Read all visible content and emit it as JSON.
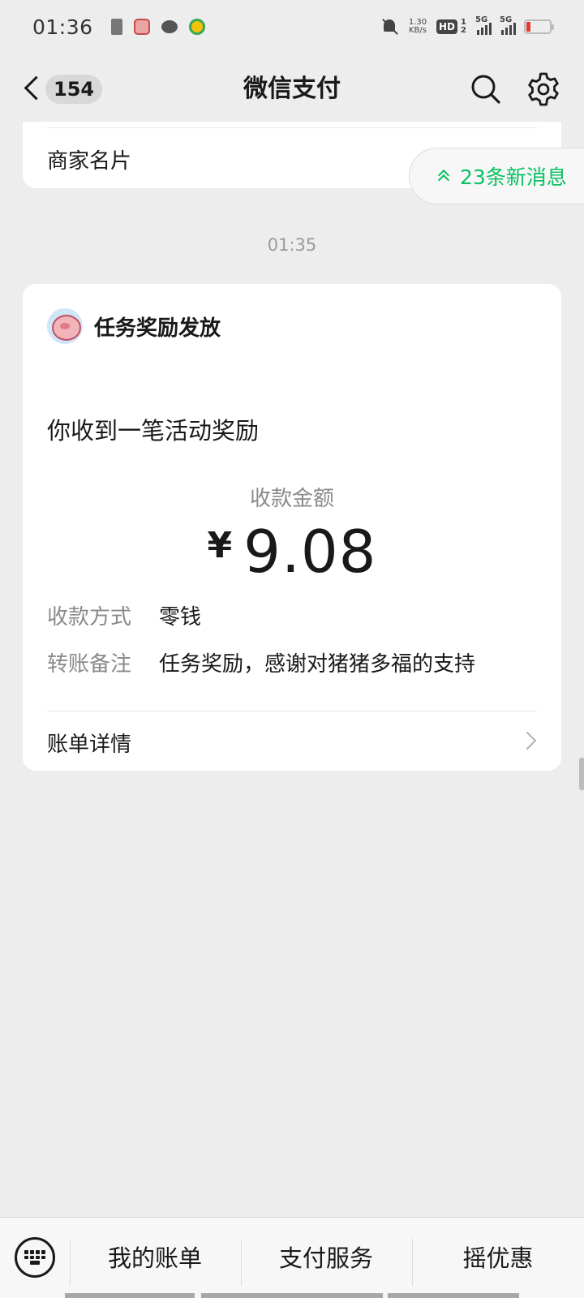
{
  "status_bar": {
    "time": "01:36",
    "net_speed_value": "1.30",
    "net_speed_unit": "KB/s",
    "hd_label": "HD",
    "hd_sup": "1",
    "hd_sub": "2",
    "signal1_label": "5G",
    "signal2_label": "5G"
  },
  "nav": {
    "unread_count": "154",
    "title": "微信支付"
  },
  "top_card": {
    "label": "商家名片"
  },
  "new_messages": {
    "label": "23条新消息"
  },
  "timestamp": "01:35",
  "message": {
    "sender": "任务奖励发放",
    "headline": "你收到一笔活动奖励",
    "amount_label": "收款金额",
    "currency": "¥",
    "amount": "9.08",
    "method_label": "收款方式",
    "method_value": "零钱",
    "remark_label": "转账备注",
    "remark_value": "任务奖励，感谢对猪猪多福的支持",
    "bill_details_label": "账单详情"
  },
  "bottom_menu": {
    "items": [
      "我的账单",
      "支付服务",
      "摇优惠"
    ]
  },
  "colors": {
    "accent_green": "#07c160",
    "background": "#ededed"
  }
}
